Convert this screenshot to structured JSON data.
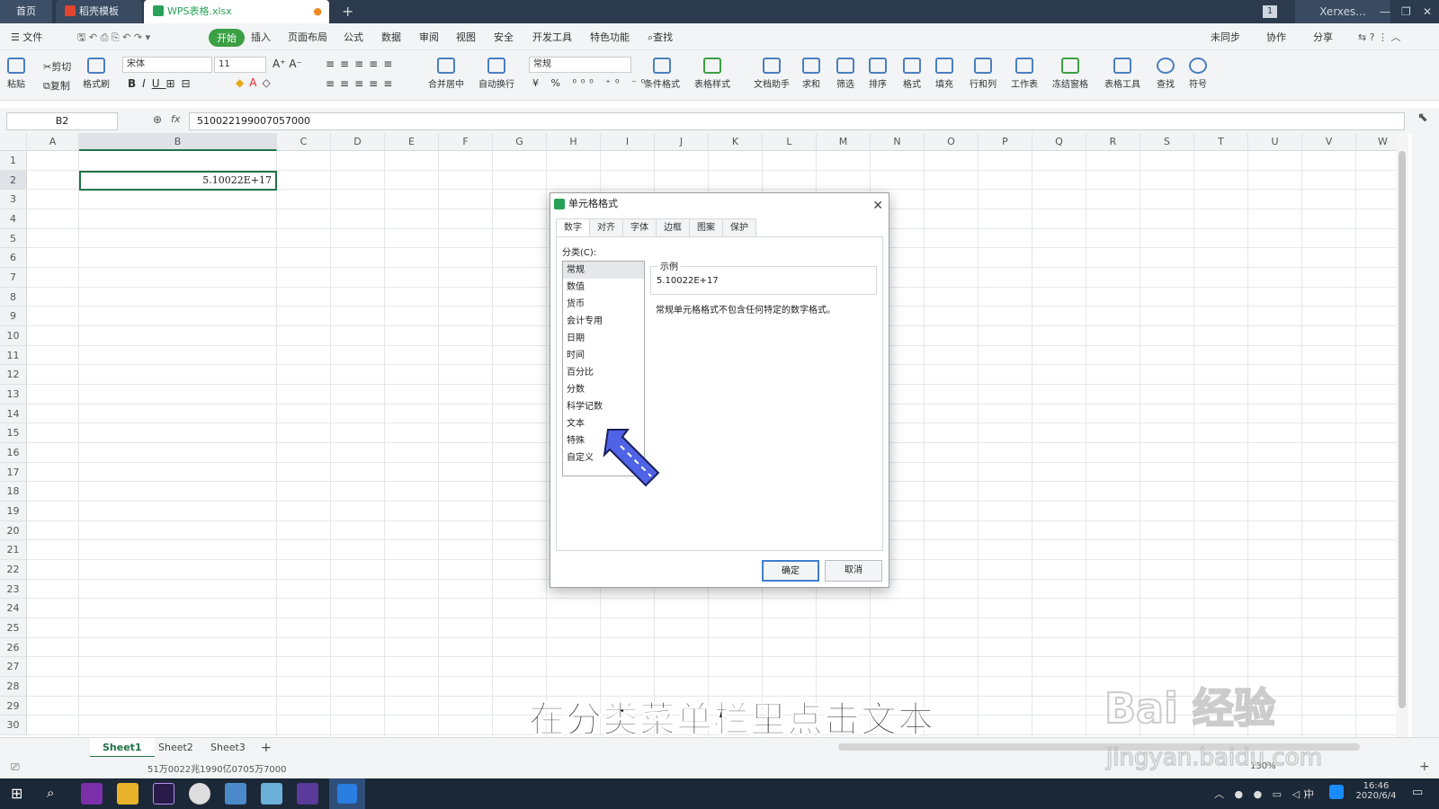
{
  "titlebar": {
    "tabs": [
      "首页",
      "稻壳模板",
      "WPS表格.xlsx"
    ],
    "account": "Xerxes...",
    "badge": "1",
    "new_tab": "+"
  },
  "menubar": {
    "file": "☰ 文件",
    "items": [
      "开始",
      "插入",
      "页面布局",
      "公式",
      "数据",
      "审阅",
      "视图",
      "安全",
      "开发工具",
      "特色功能"
    ],
    "search": "查找",
    "right": [
      "未同步",
      "协作",
      "分享"
    ]
  },
  "ribbon": {
    "clip": {
      "paste": "粘贴",
      "cut": "剪切",
      "copy": "复制",
      "painter": "格式刷"
    },
    "font_name": "宋体",
    "font_size": "11",
    "number_format": "常规",
    "big": [
      "合并居中",
      "自动换行",
      "条件格式",
      "表格样式",
      "文档助手",
      "求和",
      "筛选",
      "排序",
      "格式",
      "填充",
      "行和列",
      "工作表",
      "冻结窗格",
      "表格工具",
      "查找",
      "符号"
    ]
  },
  "formula": {
    "namebox": "B2",
    "fx": "fx",
    "value": "510022199007057000"
  },
  "columns": [
    "A",
    "B",
    "C",
    "D",
    "E",
    "F",
    "G",
    "H",
    "I",
    "J",
    "K",
    "L",
    "M",
    "N",
    "O",
    "P",
    "Q",
    "R",
    "S",
    "T",
    "U",
    "V",
    "W"
  ],
  "rows": [
    "1",
    "2",
    "3",
    "4",
    "5",
    "6",
    "7",
    "8",
    "9",
    "10",
    "11",
    "12",
    "13",
    "14",
    "15",
    "16",
    "17",
    "18",
    "19",
    "20",
    "21",
    "22",
    "23",
    "24",
    "25",
    "26",
    "27",
    "28",
    "29",
    "30"
  ],
  "cell_b2": "5.10022E+17",
  "sheets": [
    "Sheet1",
    "Sheet2",
    "Sheet3"
  ],
  "status": {
    "text": "51万0022兆1990亿0705万7000",
    "zoom": "130%"
  },
  "taskbar": {
    "time": "16:46",
    "date": "2020/6/4",
    "ime": "中"
  },
  "dialog": {
    "title": "单元格格式",
    "tabs": [
      "数字",
      "对齐",
      "字体",
      "边框",
      "图案",
      "保护"
    ],
    "category_label": "分类(C):",
    "categories": [
      "常规",
      "数值",
      "货币",
      "会计专用",
      "日期",
      "时间",
      "百分比",
      "分数",
      "科学记数",
      "文本",
      "特殊",
      "自定义"
    ],
    "sample_label": "示例",
    "sample_value": "5.10022E+17",
    "description": "常规单元格格式不包含任何特定的数字格式。",
    "ok": "确定",
    "cancel": "取消"
  },
  "overlay": {
    "subtitle": "在分类菜单栏里点击文本",
    "watermark": "Bai 经验",
    "watermark_url": "jingyan.baidu.com"
  }
}
